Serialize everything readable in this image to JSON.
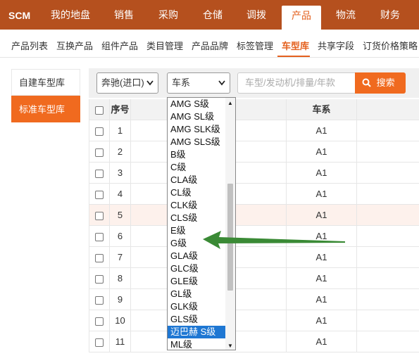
{
  "app": {
    "logo": "SCM"
  },
  "topnav": {
    "items": [
      "我的地盘",
      "销售",
      "采购",
      "仓储",
      "调拨",
      "产品",
      "物流",
      "财务"
    ],
    "active_index": 5
  },
  "subnav": {
    "items": [
      "产品列表",
      "互换产品",
      "组件产品",
      "类目管理",
      "产品品牌",
      "标签管理",
      "车型库",
      "共享字段",
      "订货价格策略"
    ],
    "active_index": 6
  },
  "leftmenu": {
    "items": [
      "自建车型库",
      "标准车型库"
    ],
    "active_index": 1
  },
  "filters": {
    "brand_value": "奔驰(进口)",
    "series_value": "车系",
    "search_placeholder": "车型/发动机/排量/年款",
    "search_button": "搜索"
  },
  "table": {
    "headers": {
      "no": "序号",
      "series": "车系"
    },
    "rows": [
      {
        "no": "1",
        "series": "A1"
      },
      {
        "no": "2",
        "series": "A1"
      },
      {
        "no": "3",
        "series": "A1"
      },
      {
        "no": "4",
        "series": "A1"
      },
      {
        "no": "5",
        "series": "A1"
      },
      {
        "no": "6",
        "series": "A1"
      },
      {
        "no": "7",
        "series": "A1"
      },
      {
        "no": "8",
        "series": "A1"
      },
      {
        "no": "9",
        "series": "A1"
      },
      {
        "no": "10",
        "series": "A1"
      },
      {
        "no": "11",
        "series": "A1"
      }
    ],
    "highlighted_row_index": 4
  },
  "dropdown": {
    "options": [
      "AMG S级",
      "AMG SL级",
      "AMG SLK级",
      "AMG SLS级",
      "B级",
      "C级",
      "CLA级",
      "CL级",
      "CLK级",
      "CLS级",
      "E级",
      "G级",
      "GLA级",
      "GLC级",
      "GLE级",
      "GL级",
      "GLK级",
      "GLS级",
      "迈巴赫 S级",
      "ML级"
    ],
    "highlighted_index": 18
  },
  "colors": {
    "nav_bg": "#b5501e",
    "accent": "#f06a1f",
    "select_highlight": "#1e77d3",
    "arrow": "#3a8a35"
  },
  "icons": {
    "search": "search-icon",
    "chevron": "chevron-down-icon",
    "arrow": "arrow-left-icon"
  }
}
